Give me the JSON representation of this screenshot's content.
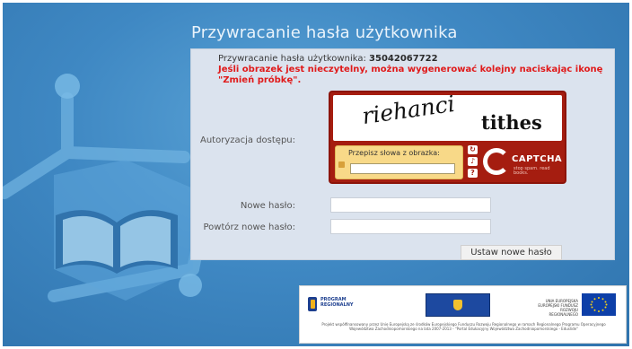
{
  "page": {
    "title": "Przywracanie hasła użytkownika"
  },
  "info": {
    "label": "Przywracanie hasła użytkownika:",
    "user_id": "35042067722",
    "warning": "Jeśli obrazek jest nieczytelny, można wygenerować kolejny naciskając ikonę \"Zmień próbkę\"."
  },
  "form": {
    "captcha_label": "Autoryzacja dostępu:",
    "new_password_label": "Nowe hasło:",
    "repeat_password_label": "Powtórz nowe hasło:",
    "new_password_value": "",
    "repeat_password_value": "",
    "submit_label": "Ustaw nowe hasło"
  },
  "captcha": {
    "word1": "riehanci",
    "word2": "tithes",
    "prompt": "Przepisz słowa z obrazka:",
    "response_value": "",
    "buttons": [
      "refresh-icon",
      "audio-icon",
      "help-icon"
    ],
    "brand": "CAPTCHA",
    "tagline": "stop spam. read books."
  },
  "footer": {
    "left_logo": "PROGRAM REGIONALNY",
    "right_logo_text": "UNIA EUROPEJSKA EUROPEJSKI FUNDUSZ ROZWOJU REGIONALNEGO",
    "note": "Projekt współfinansowany przez Unię Europejską ze środków Europejskiego Funduszu Rozwoju Regionalnego w ramach Regionalnego Programu Operacyjnego Województwa Zachodniopomorskiego na lata 2007-2013 - \"Portal Edukacyjny Województwa Zachodniopomorskiego - Eduslide\""
  },
  "colors": {
    "background": "#3f88c3",
    "panel": "#dbe3ee",
    "warning": "#e01a1a",
    "captcha_frame": "#a51d10",
    "captcha_input": "#f8d988"
  }
}
